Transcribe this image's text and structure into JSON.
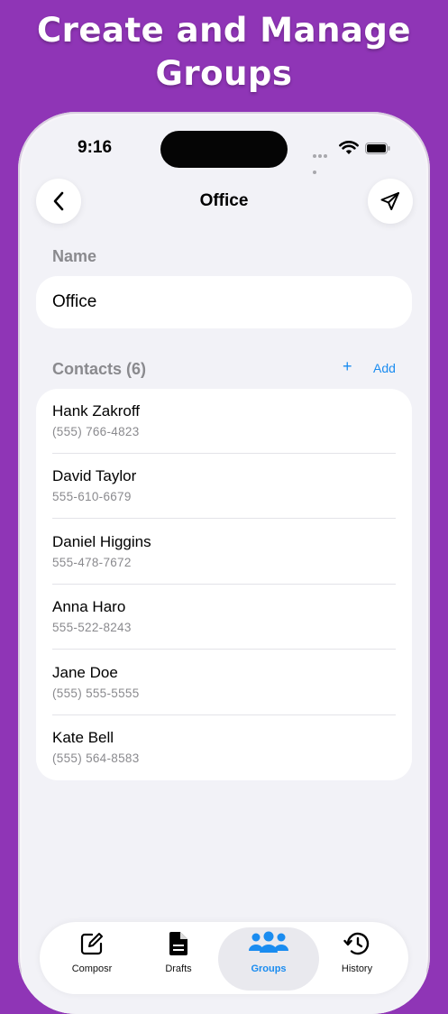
{
  "promo": {
    "line1": "Create and Manage",
    "line2": "Groups"
  },
  "status": {
    "time": "9:16"
  },
  "header": {
    "title": "Office",
    "back_icon": "chevron-left-icon",
    "send_icon": "paper-plane-icon"
  },
  "name_section": {
    "label": "Name",
    "value": "Office"
  },
  "contacts_section": {
    "label": "Contacts (6)",
    "add_label": "Add",
    "add_icon": "plus-icon",
    "contacts": [
      {
        "name": "Hank Zakroff",
        "phone": "(555) 766-4823"
      },
      {
        "name": "David Taylor",
        "phone": "555-610-6679"
      },
      {
        "name": "Daniel Higgins",
        "phone": "555-478-7672"
      },
      {
        "name": "Anna Haro",
        "phone": "555-522-8243"
      },
      {
        "name": "Jane Doe",
        "phone": "(555) 555-5555"
      },
      {
        "name": "Kate Bell",
        "phone": "(555) 564-8583"
      }
    ]
  },
  "tabs": [
    {
      "label": "Composr",
      "icon": "compose-icon",
      "active": false
    },
    {
      "label": "Drafts",
      "icon": "document-icon",
      "active": false
    },
    {
      "label": "Groups",
      "icon": "people-icon",
      "active": true
    },
    {
      "label": "History",
      "icon": "clock-history-icon",
      "active": false
    }
  ],
  "colors": {
    "background": "#8f35b6",
    "accent": "#1a8cf0"
  }
}
